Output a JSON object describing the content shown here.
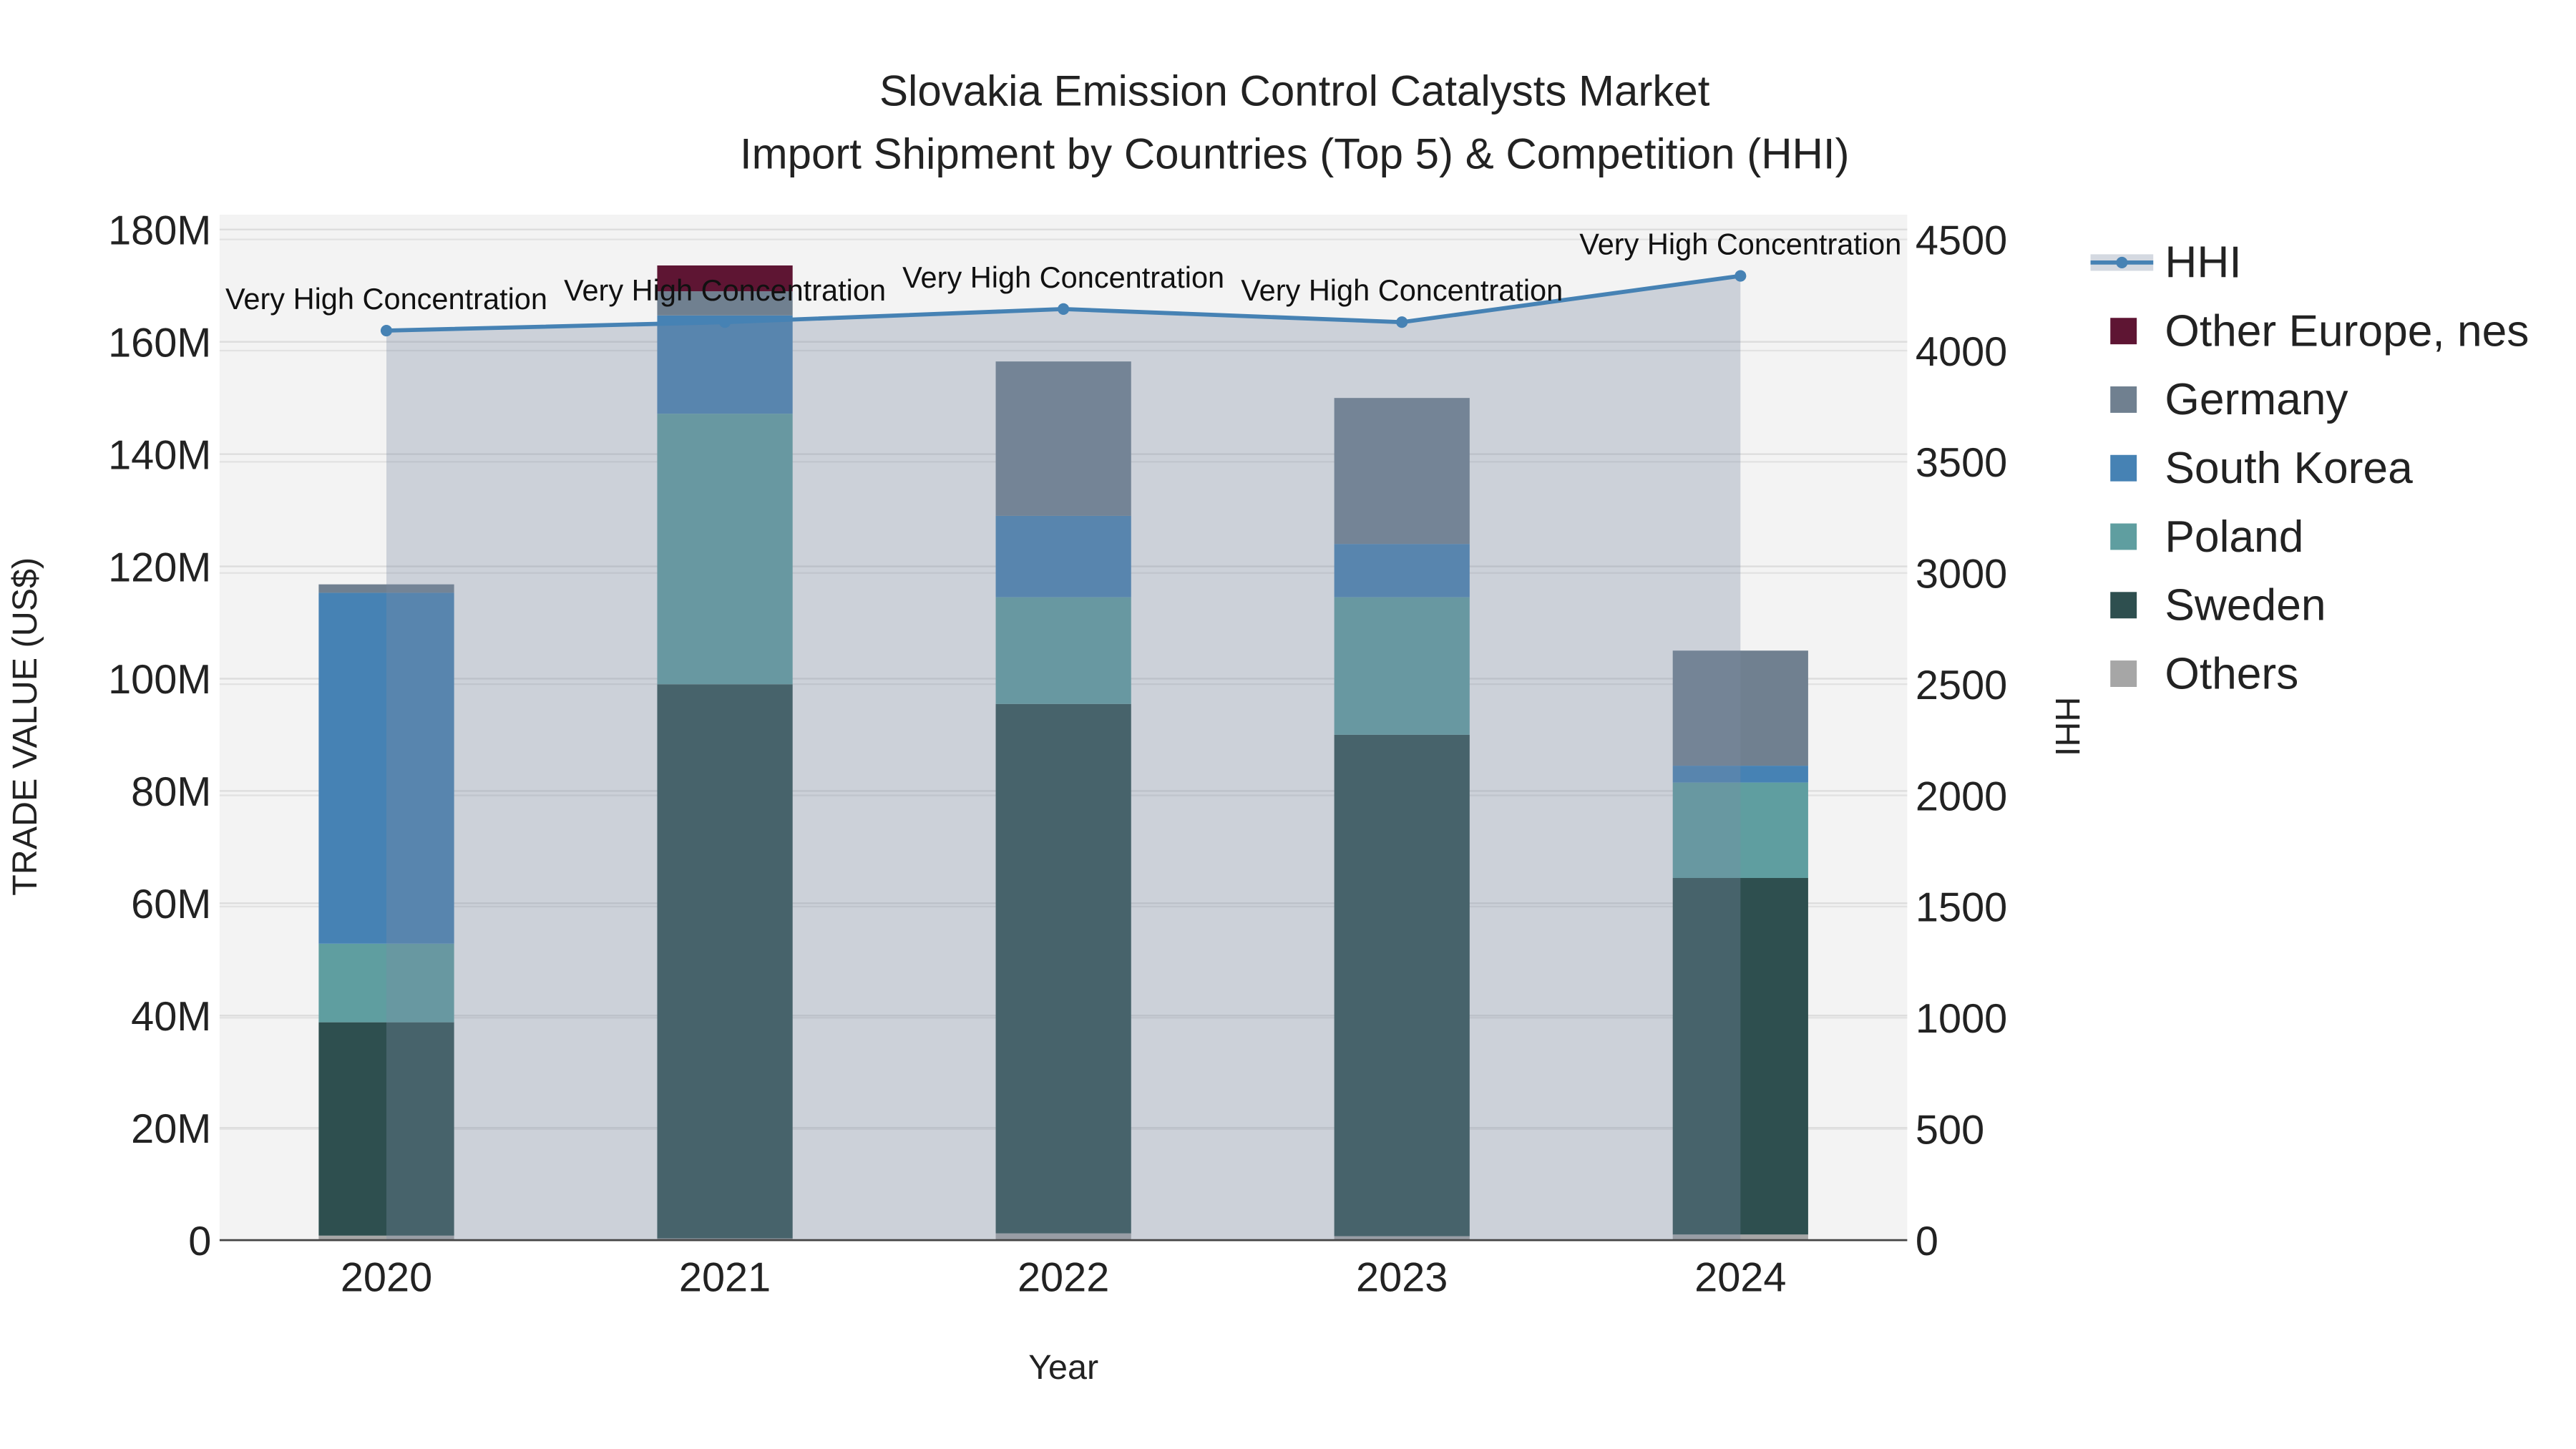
{
  "chart_data": {
    "type": "bar",
    "title": "Slovakia Emission Control Catalysts Market",
    "subtitle": "Import Shipment by Countries (Top 5) & Competition (HHI)",
    "xlabel": "Year",
    "ylabel": "TRADE VALUE (US$)",
    "y2label": "HHI",
    "categories": [
      "2020",
      "2021",
      "2022",
      "2023",
      "2024"
    ],
    "ylim": [
      0,
      180000000
    ],
    "y_ticks": [
      0,
      20000000,
      40000000,
      60000000,
      80000000,
      100000000,
      120000000,
      140000000,
      160000000,
      180000000
    ],
    "y_tick_labels": [
      "0",
      "20M",
      "40M",
      "60M",
      "80M",
      "100M",
      "120M",
      "140M",
      "160M",
      "180M"
    ],
    "y2lim": [
      0,
      4500
    ],
    "y2_ticks": [
      0,
      500,
      1000,
      1500,
      2000,
      2500,
      3000,
      3500,
      4000,
      4500
    ],
    "y2_tick_labels": [
      "0",
      "500",
      "1000",
      "1500",
      "2000",
      "2500",
      "3000",
      "3500",
      "4000",
      "4500"
    ],
    "stack_order": [
      "Others",
      "Sweden",
      "Poland",
      "South Korea",
      "Germany",
      "Other Europe, nes"
    ],
    "series": [
      {
        "name": "Others",
        "color": "#a6a6a6",
        "values": [
          800000,
          300000,
          1200000,
          700000,
          1000000
        ]
      },
      {
        "name": "Sweden",
        "color": "#2e4f4f",
        "values": [
          38000000,
          98700000,
          94300000,
          89300000,
          63500000
        ]
      },
      {
        "name": "Poland",
        "color": "#5f9ea0",
        "values": [
          14000000,
          48200000,
          19000000,
          24500000,
          17000000
        ]
      },
      {
        "name": "South Korea",
        "color": "#4682b4",
        "values": [
          62500000,
          17500000,
          14500000,
          9500000,
          3000000
        ]
      },
      {
        "name": "Germany",
        "color": "#708090",
        "values": [
          1500000,
          4300000,
          27500000,
          26000000,
          20500000
        ]
      },
      {
        "name": "Other Europe, nes",
        "color": "#5e1533",
        "values": [
          0,
          4600000,
          0,
          0,
          0
        ]
      }
    ],
    "hhi": {
      "name": "HHI",
      "color": "#4682b4",
      "values": [
        4090,
        4128,
        4187,
        4128,
        4336
      ]
    },
    "annotations": [
      "Very High Concentration",
      "Very High Concentration",
      "Very High Concentration",
      "Very High Concentration",
      "Very High Concentration"
    ],
    "legend": [
      "HHI",
      "Other Europe, nes",
      "Germany",
      "South Korea",
      "Poland",
      "Sweden",
      "Others"
    ],
    "legend_position": "right",
    "grid": true
  }
}
